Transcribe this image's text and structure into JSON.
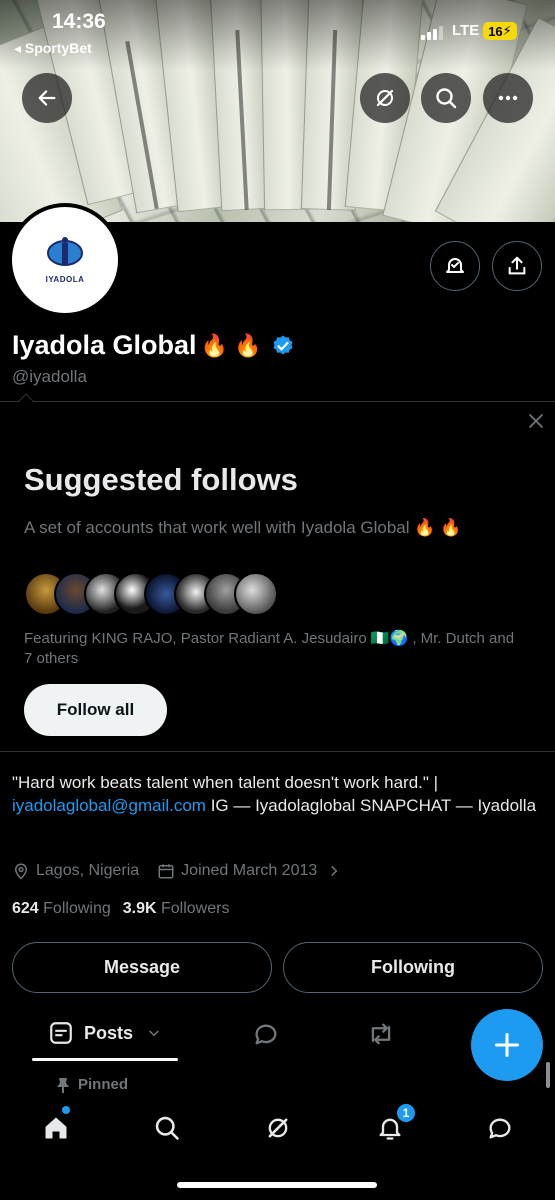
{
  "status_bar": {
    "time": "14:36",
    "back_app": "◂ SportyBet",
    "network": "LTE",
    "battery": "16"
  },
  "profile": {
    "avatar_text": "IYADOLA",
    "name": "Iyadola Global",
    "name_emoji": "🔥 🔥",
    "handle": "@iyadolla"
  },
  "suggested": {
    "title": "Suggested follows",
    "subtitle": "A set of accounts that work well with Iyadola Global 🔥 🔥",
    "featuring": "Featuring KING RAJO, Pastor Radiant A. Jesudairo 🇳🇬🌍 , Mr. Dutch and 7 others",
    "follow_all": "Follow all"
  },
  "bio": {
    "quote": "\"Hard work beats talent when talent doesn't work hard.\" |",
    "email": "iyadolaglobal@gmail.com",
    "rest": " IG — Iyadolaglobal SNAPCHAT — Iyadolla",
    "location": "Lagos, Nigeria",
    "joined": "Joined March 2013"
  },
  "counts": {
    "following_num": "624",
    "following_label": "Following",
    "followers_num": "3.9K",
    "followers_label": "Followers"
  },
  "actions": {
    "message": "Message",
    "following": "Following"
  },
  "tabs": {
    "posts": "Posts"
  },
  "pinned": "Pinned",
  "nav": {
    "notifications_badge": "1"
  },
  "colors": {
    "accent": "#1d9bf0",
    "background": "#000000",
    "muted": "#71767b"
  }
}
